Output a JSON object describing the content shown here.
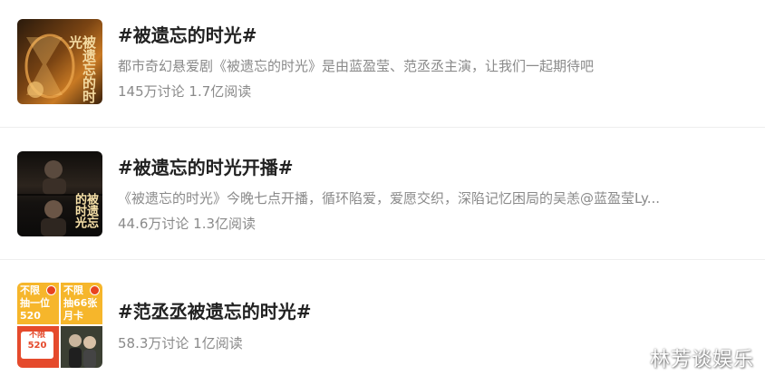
{
  "topics": [
    {
      "title": "#被遗忘的时光#",
      "description": "都市奇幻悬爱剧《被遗忘的时光》是由蓝盈莹、范丞丞主演，让我们一起期待吧",
      "stats": "145万讨论 1.7亿阅读",
      "thumb_text": "被遗忘的时光"
    },
    {
      "title": "#被遗忘的时光开播#",
      "description": "《被遗忘的时光》今晚七点开播，循环陷爱，爱愿交织，深陷记忆困局的吴恙@蓝盈莹Ly...",
      "stats": "44.6万讨论 1.3亿阅读",
      "thumb_text": "被遗忘的时光"
    },
    {
      "title": "#范丞丞被遗忘的时光#",
      "stats": "58.3万讨论 1亿阅读",
      "thumb_cells": [
        {
          "l1": "不限",
          "l2": "抽一位",
          "l3": "520"
        },
        {
          "l1": "不限",
          "l2": "抽66张",
          "l3": "月卡"
        },
        {
          "l1": "不限",
          "l2": "520",
          "l3": ""
        },
        {
          "l1": "",
          "l2": "",
          "l3": ""
        }
      ]
    }
  ],
  "watermark": "林芳谈娱乐",
  "colors": {
    "title": "#222222",
    "meta": "#8a8a8a",
    "divider": "#eeeeee",
    "accent": "#f6b62b"
  }
}
